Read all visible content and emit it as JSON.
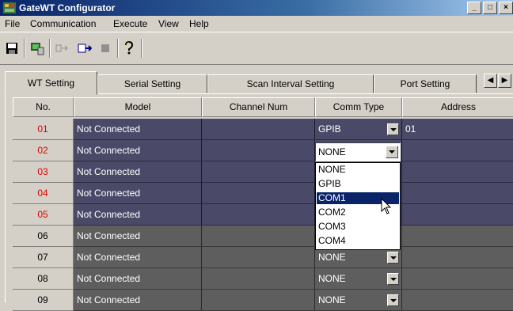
{
  "window": {
    "title": "GateWT Configurator",
    "buttons": [
      "_",
      "□",
      "×"
    ]
  },
  "menu": [
    "File",
    "Communication",
    "Execute",
    "View",
    "Help"
  ],
  "toolbar": {
    "icons": [
      "save-icon",
      "connect-icon",
      "transfer-icon",
      "run-icon",
      "stop-icon",
      "help-icon"
    ]
  },
  "tabs": [
    "WT Setting",
    "Serial Setting",
    "Scan Interval Setting",
    "Port Setting"
  ],
  "tab_scroll": [
    "◀",
    "▶"
  ],
  "grid": {
    "headers": [
      "No.",
      "Model",
      "Channel Num",
      "Comm Type",
      "Address"
    ],
    "rows": [
      {
        "no": "01",
        "model": "Not Connected",
        "comm": "GPIB",
        "address": "01"
      },
      {
        "no": "02",
        "model": "Not Connected",
        "comm": "NONE",
        "address": ""
      },
      {
        "no": "03",
        "model": "Not Connected",
        "comm": "",
        "address": ""
      },
      {
        "no": "04",
        "model": "Not Connected",
        "comm": "",
        "address": ""
      },
      {
        "no": "05",
        "model": "Not Connected",
        "comm": "",
        "address": ""
      },
      {
        "no": "06",
        "model": "Not Connected",
        "comm": "",
        "address": ""
      },
      {
        "no": "07",
        "model": "Not Connected",
        "comm": "NONE",
        "address": ""
      },
      {
        "no": "08",
        "model": "Not Connected",
        "comm": "NONE",
        "address": ""
      },
      {
        "no": "09",
        "model": "Not Connected",
        "comm": "NONE",
        "address": ""
      }
    ]
  },
  "dropdown": {
    "current": "NONE",
    "options": [
      "NONE",
      "GPIB",
      "COM1",
      "COM2",
      "COM3",
      "COM4"
    ],
    "highlighted": "COM1"
  },
  "colors": {
    "title_start": "#0a246a",
    "row_active": "#4a4a68",
    "row_inactive": "#5e5e5e",
    "row_number_red": "#e00000",
    "selection": "#0a246a"
  }
}
